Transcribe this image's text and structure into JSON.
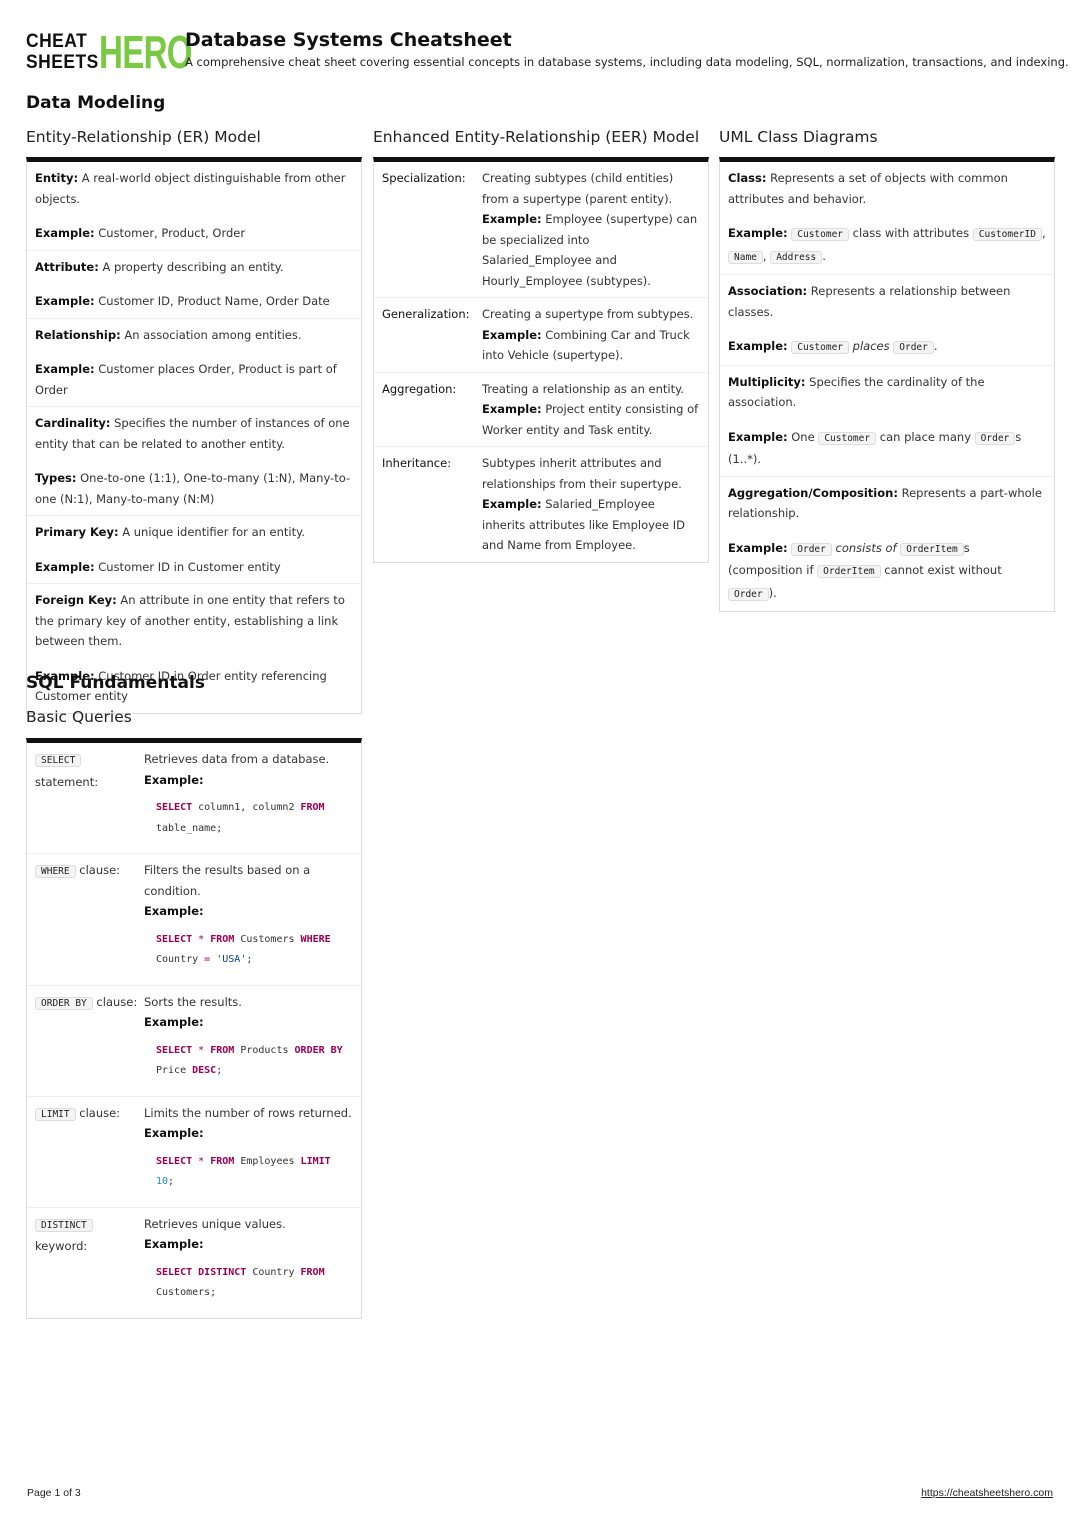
{
  "logo": {
    "line1": "CHEAT",
    "line2": "SHEETS",
    "hero": "HERO"
  },
  "header": {
    "title": "Database Systems Cheatsheet",
    "subtitle": "A comprehensive cheat sheet covering essential concepts in database systems, including data modeling, SQL, normalization, transactions, and indexing."
  },
  "sections": {
    "data_modeling": "Data Modeling",
    "sql_fundamentals": "SQL Fundamentals"
  },
  "er": {
    "title": "Entity-Relationship (ER) Model",
    "rows": [
      {
        "term": "Entity:",
        "desc": "A real-world object distinguishable from other objects.",
        "ex_label": "Example:",
        "ex": "Customer, Product, Order"
      },
      {
        "term": "Attribute:",
        "desc": "A property describing an entity.",
        "ex_label": "Example:",
        "ex": "Customer ID, Product Name, Order Date"
      },
      {
        "term": "Relationship:",
        "desc": "An association among entities.",
        "ex_label": "Example:",
        "ex": "Customer places Order, Product is part of Order"
      },
      {
        "term": "Cardinality:",
        "desc": "Specifies the number of instances of one entity that can be related to another entity.",
        "ex_label": "Types:",
        "ex": "One-to-one (1:1), One-to-many (1:N), Many-to-one (N:1), Many-to-many (N:M)"
      },
      {
        "term": "Primary Key:",
        "desc": "A unique identifier for an entity.",
        "ex_label": "Example:",
        "ex": "Customer ID in Customer entity"
      },
      {
        "term": "Foreign Key:",
        "desc": "An attribute in one entity that refers to the primary key of another entity, establishing a link between them.",
        "ex_label": "Example:",
        "ex": "Customer ID in Order entity referencing Customer entity"
      }
    ]
  },
  "eer": {
    "title": "Enhanced Entity-Relationship (EER) Model",
    "rows": [
      {
        "term": "Specialization:",
        "desc": "Creating subtypes (child entities) from a supertype (parent entity).",
        "ex_label": "Example:",
        "ex": "Employee (supertype) can be specialized into Salaried_Employee and Hourly_Employee (subtypes)."
      },
      {
        "term": "Generalization:",
        "desc": "Creating a supertype from subtypes.",
        "ex_label": "Example:",
        "ex": "Combining Car and Truck into Vehicle (supertype)."
      },
      {
        "term": "Aggregation:",
        "desc": "Treating a relationship as an entity.",
        "ex_label": "Example:",
        "ex": "Project entity consisting of Worker entity and Task entity."
      },
      {
        "term": "Inheritance:",
        "desc": "Subtypes inherit attributes and relationships from their supertype.",
        "ex_label": "Example:",
        "ex": "Salaried_Employee inherits attributes like Employee ID and Name from Employee."
      }
    ]
  },
  "uml": {
    "title": "UML Class Diagrams",
    "class": {
      "term": "Class:",
      "desc": "Represents a set of objects with common attributes and behavior.",
      "ex_label": "Example:",
      "c1": "Customer",
      "t1": " class with attributes ",
      "c2": "CustomerID",
      "t2": ", ",
      "c3": "Name",
      "t3": ", ",
      "c4": "Address",
      "t4": "."
    },
    "association": {
      "term": "Association:",
      "desc": "Represents a relationship between classes.",
      "ex_label": "Example:",
      "c1": "Customer",
      "t1": "places",
      "c2": "Order",
      "t2": "."
    },
    "multiplicity": {
      "term": "Multiplicity:",
      "desc": "Specifies the cardinality of the association.",
      "ex_label": "Example:",
      "t0": "One ",
      "c1": "Customer",
      "t1": " can place many ",
      "c2": "Order",
      "t2": "s (1..*)."
    },
    "aggregation": {
      "term": "Aggregation/Composition:",
      "desc": "Represents a part-whole relationship.",
      "ex_label": "Example:",
      "c1": "Order",
      "t1": "consists of",
      "c2": "OrderItem",
      "t2": "s (composition if ",
      "c3": "OrderItem",
      "t3": " cannot exist without ",
      "c4": "Order",
      "t4": ")."
    }
  },
  "basic_queries": {
    "title": "Basic Queries",
    "ex_label": "Example:",
    "rows": [
      {
        "code": "SELECT",
        "suffix": "statement:",
        "desc": "Retrieves data from a database.",
        "sql": [
          {
            "t": "SELECT",
            "c": "kw"
          },
          {
            "t": " column1, column2 "
          },
          {
            "t": "FROM",
            "c": "kw"
          },
          {
            "t": " table_name;"
          }
        ]
      },
      {
        "code": "WHERE",
        "suffix": "clause:",
        "desc": "Filters the results based on a condition.",
        "sql": [
          {
            "t": "SELECT",
            "c": "kw"
          },
          {
            "t": " "
          },
          {
            "t": "*",
            "c": "op"
          },
          {
            "t": " "
          },
          {
            "t": "FROM",
            "c": "kw"
          },
          {
            "t": " Customers "
          },
          {
            "t": "WHERE",
            "c": "kw"
          },
          {
            "t": " Country "
          },
          {
            "t": "=",
            "c": "op"
          },
          {
            "t": " "
          },
          {
            "t": "'USA'",
            "c": "str"
          },
          {
            "t": ";"
          }
        ]
      },
      {
        "code": "ORDER BY",
        "suffix": "clause:",
        "desc": "Sorts the results.",
        "sql": [
          {
            "t": "SELECT",
            "c": "kw"
          },
          {
            "t": " "
          },
          {
            "t": "*",
            "c": "op"
          },
          {
            "t": " "
          },
          {
            "t": "FROM",
            "c": "kw"
          },
          {
            "t": " Products "
          },
          {
            "t": "ORDER BY",
            "c": "kw"
          },
          {
            "t": " Price "
          },
          {
            "t": "DESC",
            "c": "kw"
          },
          {
            "t": ";"
          }
        ]
      },
      {
        "code": "LIMIT",
        "suffix": "clause:",
        "desc": "Limits the number of rows returned.",
        "sql": [
          {
            "t": "SELECT",
            "c": "kw"
          },
          {
            "t": " "
          },
          {
            "t": "*",
            "c": "op"
          },
          {
            "t": " "
          },
          {
            "t": "FROM",
            "c": "kw"
          },
          {
            "t": " Employees "
          },
          {
            "t": "LIMIT",
            "c": "kw"
          },
          {
            "t": " "
          },
          {
            "t": "10",
            "c": "num"
          },
          {
            "t": ";"
          }
        ]
      },
      {
        "code": "DISTINCT",
        "suffix": "keyword:",
        "desc": "Retrieves unique values.",
        "sql": [
          {
            "t": "SELECT",
            "c": "kw"
          },
          {
            "t": " "
          },
          {
            "t": "DISTINCT",
            "c": "kw"
          },
          {
            "t": " Country "
          },
          {
            "t": "FROM",
            "c": "kw"
          },
          {
            "t": " Customers;"
          }
        ]
      }
    ]
  },
  "footer": {
    "page": "Page 1 of 3",
    "url": "https://cheatsheetshero.com"
  },
  "colors": {
    "brand_green": "#7ac943",
    "sql_keyword": "#990055",
    "sql_string": "#0b3d91",
    "sql_number": "#1a8fb7"
  }
}
